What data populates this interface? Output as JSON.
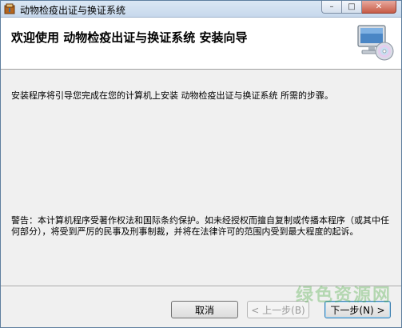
{
  "window": {
    "title": "动物检疫出证与换证系统",
    "controls": {
      "minimize": "–",
      "maximize": "□",
      "close": "✕"
    }
  },
  "header": {
    "title": "欢迎使用  动物检疫出证与换证系统  安装向导",
    "icon": "computer-cd-icon"
  },
  "body": {
    "intro": "安装程序将引导您完成在您的计算机上安装  动物检疫出证与换证系统  所需的步骤。",
    "warning": "警告：本计算机程序受著作权法和国际条约保护。如未经授权而擅自复制或传播本程序（或其中任何部分），将受到严厉的民事及刑事制裁，并将在法律许可的范围内受到最大程度的起诉。"
  },
  "buttons": {
    "cancel": "取消",
    "back": "< 上一步(B)",
    "next": "下一步(N) >"
  },
  "watermark": "绿色资源网",
  "colors": {
    "title_bar": "#c7d8ec",
    "header_bg": "#ffffff",
    "panel_bg": "#f0f0f0"
  }
}
